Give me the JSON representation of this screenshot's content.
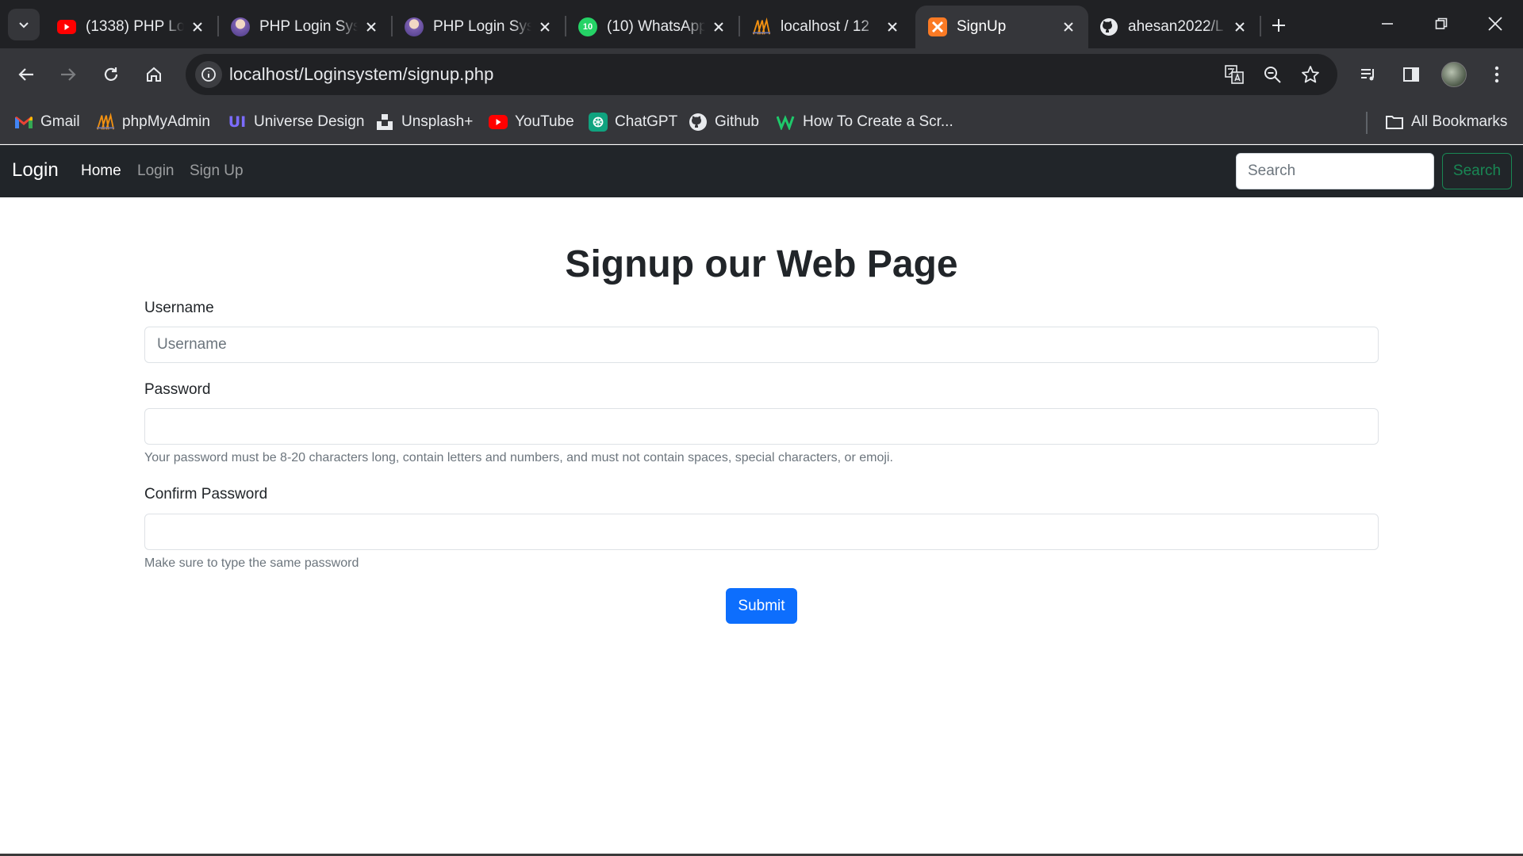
{
  "browser": {
    "tabs": [
      {
        "title": "(1338) PHP Lo",
        "icon": "youtube-icon"
      },
      {
        "title": "PHP Login Sys",
        "icon": "avatar-icon"
      },
      {
        "title": "PHP Login Sys",
        "icon": "avatar-icon"
      },
      {
        "title": "(10) WhatsApp",
        "icon": "whatsapp-icon",
        "badge": "10"
      },
      {
        "title": "localhost / 12",
        "icon": "phpmyadmin-icon"
      },
      {
        "title": "SignUp",
        "icon": "xampp-icon",
        "active": true
      },
      {
        "title": "ahesan2022/L",
        "icon": "github-icon"
      }
    ],
    "url": "localhost/Loginsystem/signup.php",
    "bookmarks": [
      {
        "label": "Gmail",
        "icon": "gmail-icon"
      },
      {
        "label": "phpMyAdmin",
        "icon": "phpmyadmin-icon"
      },
      {
        "label": "Universe Design",
        "icon": "universe-design-icon"
      },
      {
        "label": "Unsplash+",
        "icon": "unsplash-icon"
      },
      {
        "label": "YouTube",
        "icon": "youtube-icon"
      },
      {
        "label": "ChatGPT",
        "icon": "chatgpt-icon"
      },
      {
        "label": "Github",
        "icon": "github-icon"
      },
      {
        "label": "How To Create a Scr...",
        "icon": "wix-icon"
      }
    ],
    "all_bookmarks": "All Bookmarks"
  },
  "site": {
    "brand": "Login",
    "nav": [
      "Home",
      "Login",
      "Sign Up"
    ],
    "search_placeholder": "Search",
    "search_button": "Search"
  },
  "form": {
    "heading": "Signup our Web Page",
    "username_label": "Username",
    "username_placeholder": "Username",
    "password_label": "Password",
    "password_help": "Your password must be 8-20 characters long, contain letters and numbers, and must not contain spaces, special characters, or emoji.",
    "confirm_label": "Confirm Password",
    "confirm_help": "Make sure to type the same password",
    "submit": "Submit"
  },
  "colors": {
    "primary": "#0d6efd",
    "success": "#198754",
    "navbar": "#212529",
    "chrome": "#35363a"
  }
}
